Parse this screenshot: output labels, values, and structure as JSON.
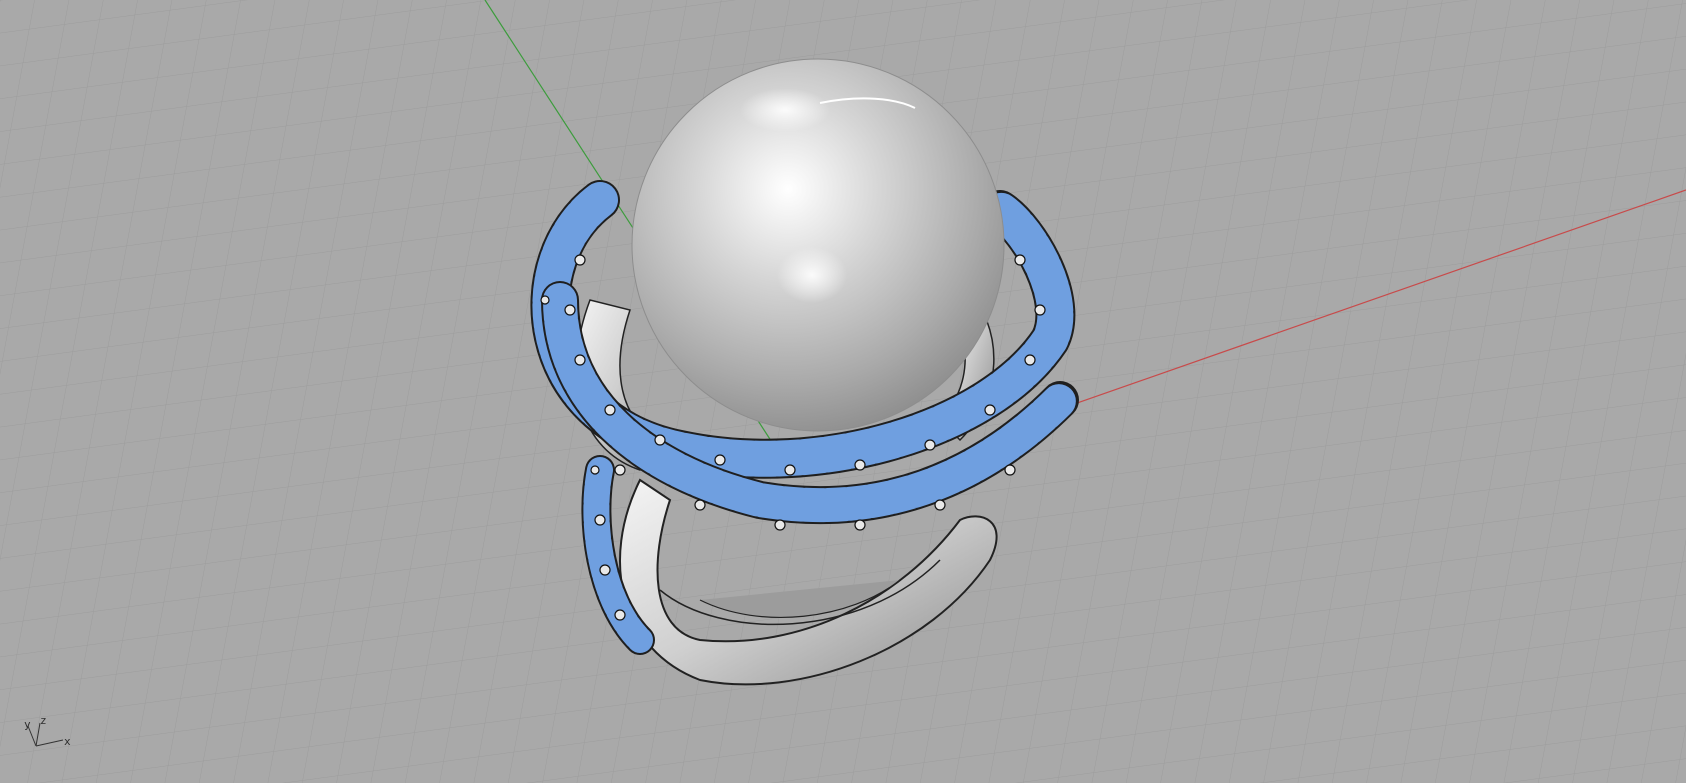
{
  "viewport": {
    "background_color": "#a9a9a9",
    "grid_color": "#9a9a9a",
    "x_axis_color": "#c84a4a",
    "y_axis_color": "#3c9c3c",
    "gem_color": "#6f9fe0",
    "metal_color": "#e6e6e6"
  },
  "axis_widget": {
    "x_label": "x",
    "y_label": "y",
    "z_label": "z"
  }
}
